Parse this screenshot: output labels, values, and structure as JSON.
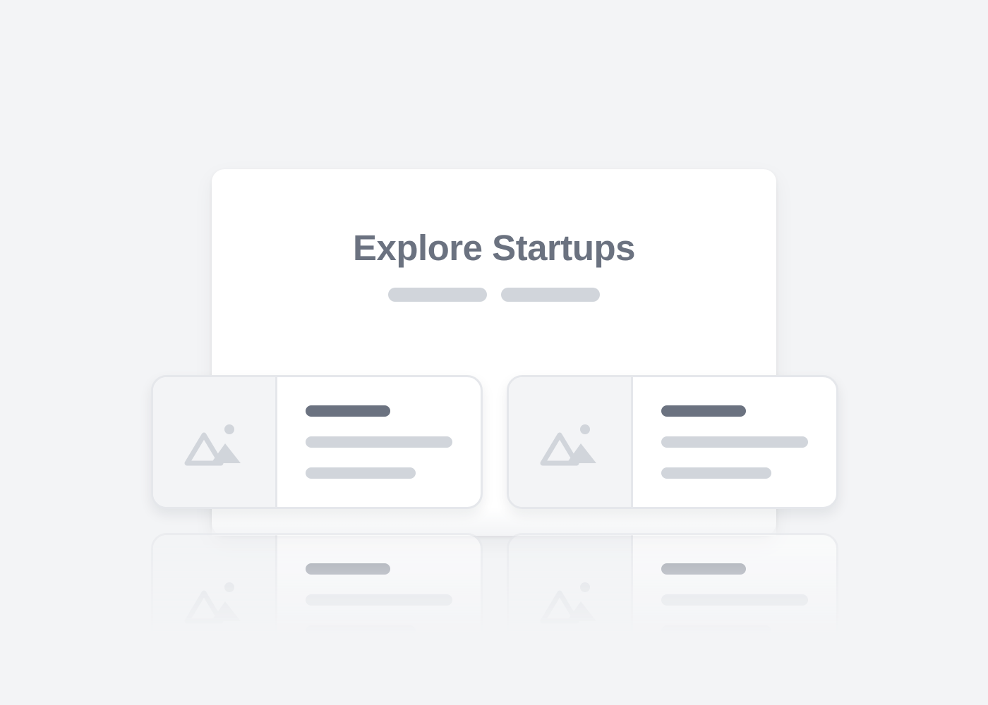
{
  "hero": {
    "title": "Explore Startups"
  },
  "cards": [
    {
      "image_icon": "image-placeholder-icon"
    },
    {
      "image_icon": "image-placeholder-icon"
    }
  ],
  "colors": {
    "background": "#f3f4f6",
    "panel": "#ffffff",
    "title_text": "#6b7280",
    "skeleton_dark": "#6b7280",
    "skeleton_light": "#d1d5db",
    "card_border": "#e5e7eb"
  }
}
